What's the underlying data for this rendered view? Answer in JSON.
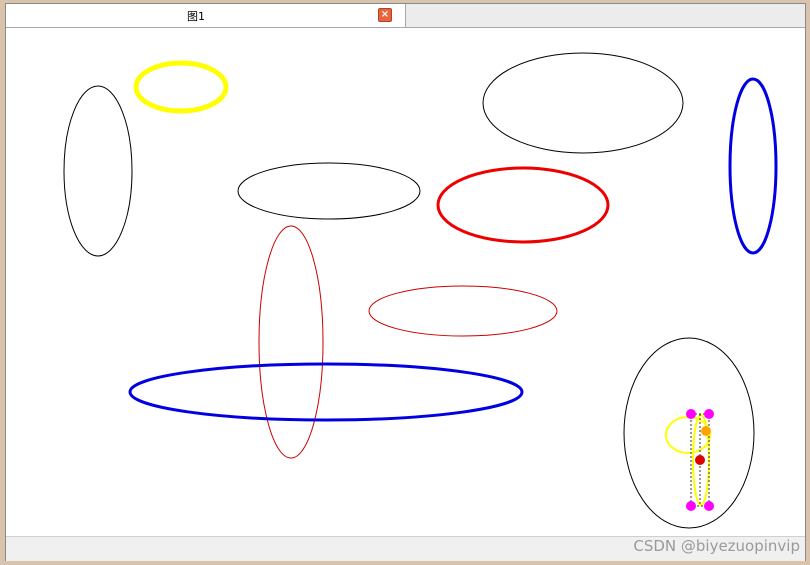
{
  "tab": {
    "title": "图1"
  },
  "watermark": "CSDN @biyezuopinvip",
  "colors": {
    "black": "#000000",
    "yellow": "#ffff00",
    "blue": "#0000e0",
    "red": "#ee0000",
    "handle": "#ff00ff",
    "rotate_handle": "#ffa500",
    "center_handle": "#dd0000"
  },
  "icons": {
    "close": "close-icon"
  }
}
